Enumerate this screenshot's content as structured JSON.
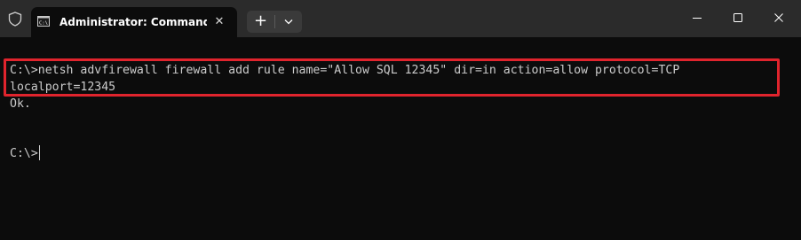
{
  "window": {
    "tab_title": "Administrator: Command Pro",
    "tab_icon": "cmd-icon",
    "shield_icon": "shield-icon",
    "new_tab_label": "+",
    "dropdown_icon": "chevron-down-icon",
    "close_tab_label": "✕"
  },
  "terminal": {
    "lines": [
      "C:\\>netsh advfirewall firewall add rule name=\"Allow SQL 12345\" dir=in action=allow protocol=TCP",
      "localport=12345",
      "Ok.",
      "C:\\>"
    ]
  },
  "colors": {
    "terminal_bg": "#0c0c0c",
    "titlebar_bg": "#2b2b2b",
    "text": "#cccccc",
    "highlight_border": "#e0242d"
  }
}
